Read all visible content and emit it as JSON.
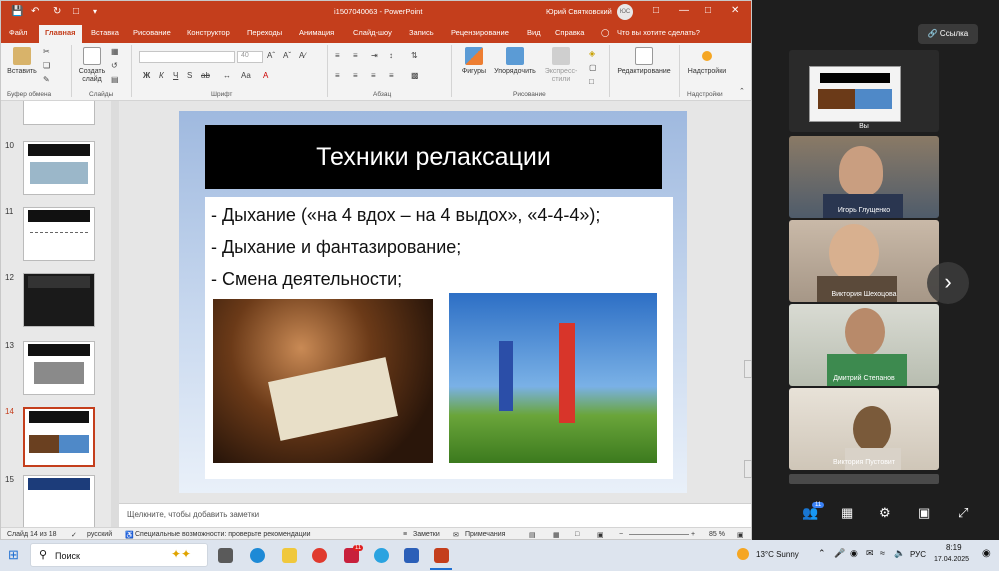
{
  "powerpoint": {
    "filename": "i1507040063",
    "app_name": "PowerPoint",
    "user": "Юрий Святковский",
    "user_initials": "ЮС",
    "tabs": [
      "Файл",
      "Главная",
      "Вставка",
      "Рисование",
      "Конструктор",
      "Переходы",
      "Анимация",
      "Слайд-шоу",
      "Запись",
      "Рецензирование",
      "Вид",
      "Справка",
      "Что вы хотите сделать?"
    ],
    "active_tab": "Главная",
    "ribbon": {
      "paste": "Вставить",
      "clipboard_group": "Буфер обмена",
      "new_slide_1": "Создать",
      "new_slide_2": "слайд",
      "slides_group": "Слайды",
      "font_size": "40",
      "font_group": "Шрифт",
      "paragraph_group": "Абзац",
      "shapes": "Фигуры",
      "arrange": "Упорядочить",
      "styles_1": "Экспресс-",
      "styles_2": "стили",
      "drawing_group": "Рисование",
      "editing": "Редактирование",
      "addins": "Надстройки",
      "addins_group": "Надстройки",
      "format_buttons": [
        "Ж",
        "К",
        "Ч",
        "S",
        "ab"
      ]
    },
    "slide_numbers": [
      "10",
      "11",
      "12",
      "13",
      "14",
      "15"
    ],
    "selected_slide": "14",
    "slide": {
      "title": "Техники релаксации",
      "bullets": [
        "-  Дыхание («на 4 вдох – на 4 выдох», «4-4-4»);",
        "-  Дыхание и фантазирование;",
        "-  Смена деятельности;"
      ]
    },
    "notes_placeholder": "Щелкните, чтобы добавить заметки",
    "status": {
      "slide_count": "Слайд 14 из 18",
      "language": "русский",
      "accessibility": "Специальные возможности: проверьте рекомендации",
      "notes": "Заметки",
      "comments": "Примечания",
      "zoom": "85 %"
    }
  },
  "meeting": {
    "link_button": "Ссылка",
    "participants": [
      {
        "name": "Вы"
      },
      {
        "name": "Игорь Глущенко"
      },
      {
        "name": "Виктория Шехоцова"
      },
      {
        "name": "Дмитрий Степанов"
      },
      {
        "name": "Виктория Пустовит"
      }
    ],
    "participant_count": "11",
    "colors": {
      "accent": "#3b82f6"
    }
  },
  "taskbar": {
    "search_placeholder": "Поиск",
    "weather": "13°C  Sunny",
    "language": "РУС",
    "time": "8:19",
    "date": "17.04.2025",
    "badge": "11"
  },
  "colors": {
    "powerpoint_red": "#c43e1c"
  }
}
